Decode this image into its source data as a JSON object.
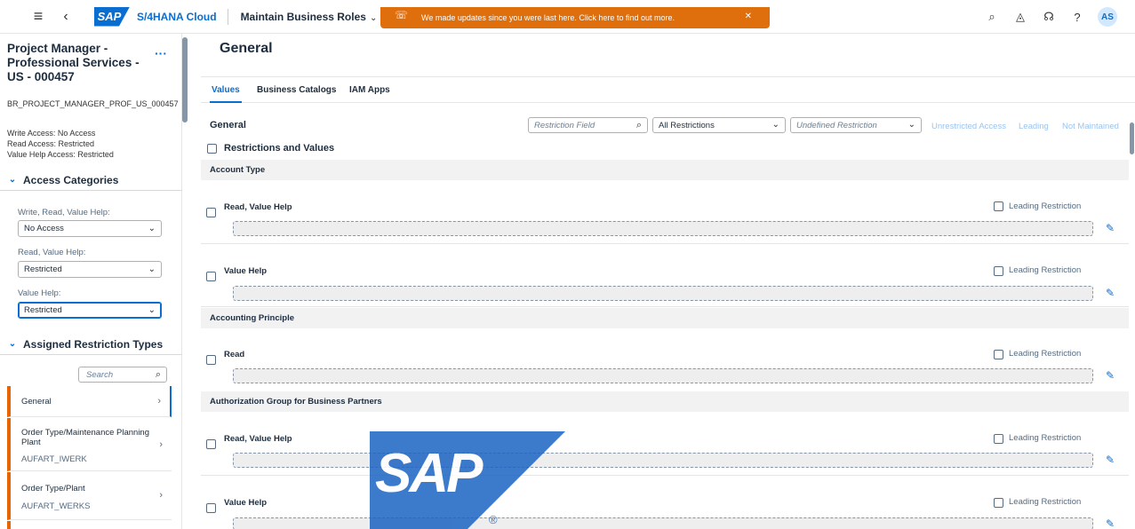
{
  "shell": {
    "product": "S/4HANA Cloud",
    "app_title": "Maintain Business Roles",
    "logo_text": "SAP",
    "avatar_initials": "AS"
  },
  "toast": {
    "message": "We made updates since you were last here. Click here to find out more."
  },
  "role": {
    "title": "Project Manager - Professional Services - US - 000457",
    "id": "BR_PROJECT_MANAGER_PROF_US_000457",
    "write_access": "Write Access: No Access",
    "read_access": "Read Access: Restricted",
    "value_help_access": "Value Help Access: Restricted"
  },
  "access_categories": {
    "header": "Access Categories",
    "fields": [
      {
        "label": "Write, Read, Value Help:",
        "value": "No Access"
      },
      {
        "label": "Read, Value Help:",
        "value": "Restricted"
      },
      {
        "label": "Value Help:",
        "value": "Restricted"
      }
    ]
  },
  "assigned_restriction_types": {
    "header": "Assigned Restriction Types",
    "search_placeholder": "Search",
    "items": [
      {
        "name": "General",
        "code": ""
      },
      {
        "name": "Order Type/Maintenance Planning Plant",
        "code": "AUFART_IWERK"
      },
      {
        "name": "Order Type/Plant",
        "code": "AUFART_WERKS"
      }
    ]
  },
  "main": {
    "title": "General",
    "tabs": [
      "Values",
      "Business Catalogs",
      "IAM Apps"
    ],
    "active_tab": "Values"
  },
  "toolbar": {
    "title": "General",
    "restriction_field_placeholder": "Restriction Field",
    "all_restrictions": "All Restrictions",
    "undefined_restriction": "Undefined Restriction",
    "links": [
      "Unrestricted Access",
      "Leading",
      "Not Maintained"
    ]
  },
  "restrictions": {
    "header": "Restrictions and Values",
    "leading_label": "Leading Restriction",
    "groups": [
      {
        "name": "Account Type",
        "rows": [
          "Read, Value Help",
          "Value Help"
        ]
      },
      {
        "name": "Accounting Principle",
        "rows": [
          "Read"
        ]
      },
      {
        "name": "Authorization Group for Business Partners",
        "rows": [
          "Read, Value Help",
          "Value Help"
        ]
      }
    ]
  },
  "colors": {
    "accent": "#0a6ed1",
    "toast": "#df6e0c",
    "item_marker": "#e76500"
  }
}
